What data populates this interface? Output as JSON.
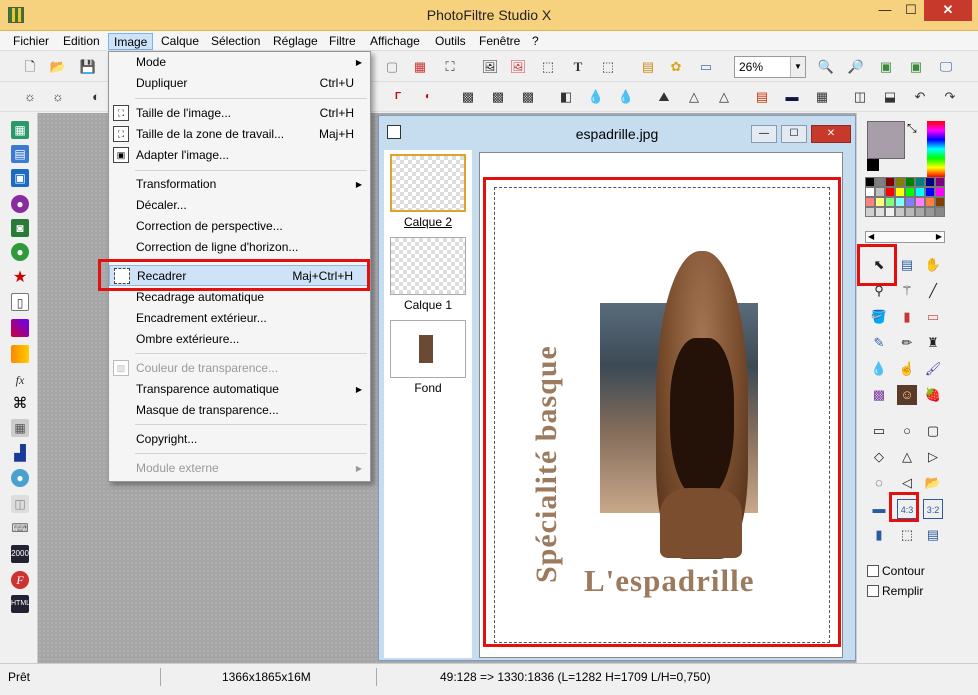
{
  "app": {
    "title": "PhotoFiltre Studio X",
    "window_controls": {
      "minimize": "—",
      "maximize": "☐",
      "close": "✕"
    }
  },
  "menubar": {
    "items": [
      "Fichier",
      "Edition",
      "Image",
      "Calque",
      "Sélection",
      "Réglage",
      "Filtre",
      "Affichage",
      "Outils",
      "Fenêtre",
      "?"
    ],
    "active": "Image"
  },
  "toolbar": {
    "zoom_value": "26%"
  },
  "image_menu": {
    "items": [
      {
        "label": "Mode",
        "shortcut": "",
        "submenu": true,
        "disabled": false
      },
      {
        "label": "Dupliquer",
        "shortcut": "Ctrl+U",
        "submenu": false,
        "disabled": false
      },
      {
        "label": "Taille de l'image...",
        "shortcut": "Ctrl+H",
        "submenu": false,
        "disabled": false
      },
      {
        "label": "Taille de la zone de travail...",
        "shortcut": "Maj+H",
        "submenu": false,
        "disabled": false
      },
      {
        "label": "Adapter l'image...",
        "shortcut": "",
        "submenu": false,
        "disabled": false
      },
      {
        "label": "Transformation",
        "shortcut": "",
        "submenu": true,
        "disabled": false
      },
      {
        "label": "Décaler...",
        "shortcut": "",
        "submenu": false,
        "disabled": false
      },
      {
        "label": "Correction de perspective...",
        "shortcut": "",
        "submenu": false,
        "disabled": false
      },
      {
        "label": "Correction de ligne d'horizon...",
        "shortcut": "",
        "submenu": false,
        "disabled": false
      },
      {
        "label": "Recadrer",
        "shortcut": "Maj+Ctrl+H",
        "submenu": false,
        "disabled": false
      },
      {
        "label": "Recadrage automatique",
        "shortcut": "",
        "submenu": false,
        "disabled": false
      },
      {
        "label": "Encadrement extérieur...",
        "shortcut": "",
        "submenu": false,
        "disabled": false
      },
      {
        "label": "Ombre extérieure...",
        "shortcut": "",
        "submenu": false,
        "disabled": false
      },
      {
        "label": "Couleur de transparence...",
        "shortcut": "",
        "submenu": false,
        "disabled": true
      },
      {
        "label": "Transparence automatique",
        "shortcut": "",
        "submenu": true,
        "disabled": false
      },
      {
        "label": "Masque de transparence...",
        "shortcut": "",
        "submenu": false,
        "disabled": false
      },
      {
        "label": "Copyright...",
        "shortcut": "",
        "submenu": false,
        "disabled": false
      },
      {
        "label": "Module externe",
        "shortcut": "",
        "submenu": true,
        "disabled": true
      }
    ],
    "highlighted": "Recadrer"
  },
  "document": {
    "title": "espadrille.jpg",
    "layers": [
      {
        "label": "Calque 2",
        "selected": true
      },
      {
        "label": "Calque 1",
        "selected": false
      },
      {
        "label": "Fond",
        "selected": false
      }
    ],
    "canvas_text_vertical": "Spécialité basque",
    "canvas_text_horizontal": "L'espadrille"
  },
  "right_panel": {
    "current_color": "#a89eaa",
    "checkboxes": {
      "contour": "Contour",
      "remplir": "Remplir"
    },
    "ratio_43": "4:3",
    "ratio_32": "3:2"
  },
  "status": {
    "state": "Prêt",
    "dimensions": "1366x1865x16M",
    "coords": "49:128 => 1330:1836 (L=1282  H=1709  L/H=0,750)"
  },
  "colors": {
    "titlebar": "#f7d27e",
    "highlight_box": "#e41010",
    "menu_highlight": "#cfe3f8"
  }
}
